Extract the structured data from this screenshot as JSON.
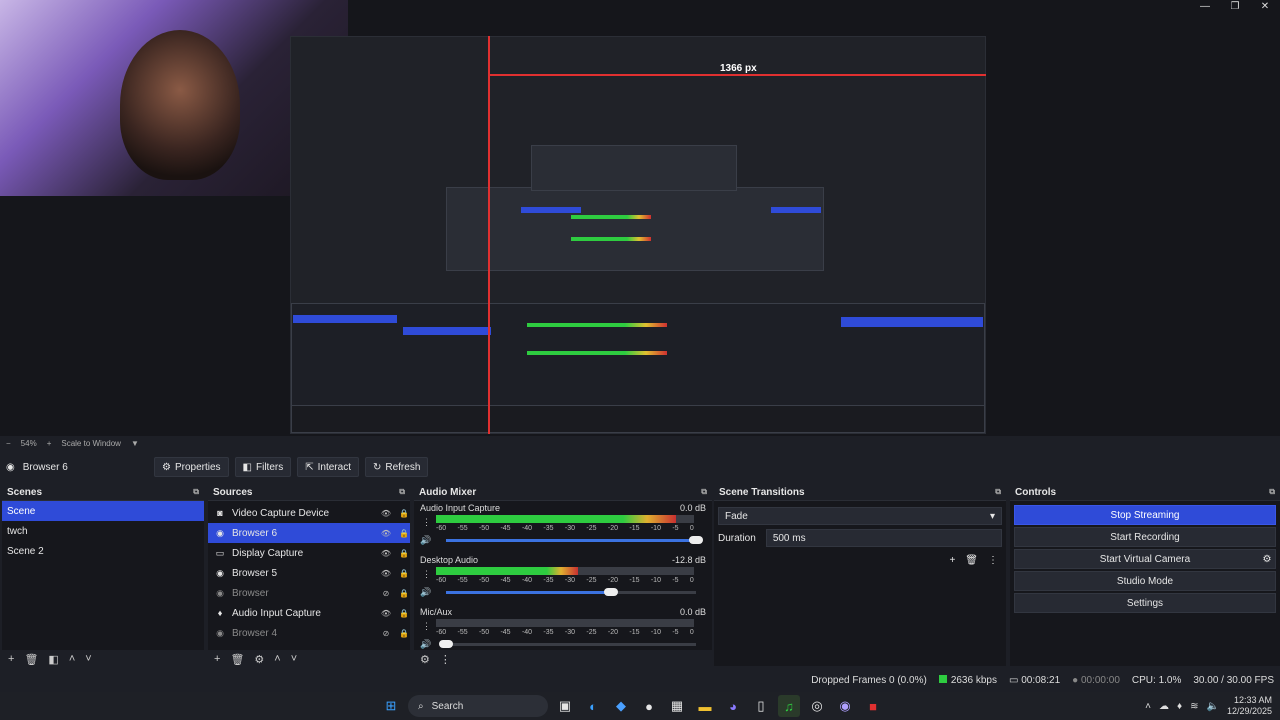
{
  "window": {
    "controls": [
      "—",
      "❐",
      "✕"
    ]
  },
  "preview": {
    "nested_width_label": "1366 px",
    "zoom_percent": "54%",
    "scale_mode": "Scale to Window"
  },
  "toolbar": {
    "source_name": "Browser 6",
    "properties": "Properties",
    "filters": "Filters",
    "interact": "Interact",
    "refresh": "Refresh"
  },
  "scenes": {
    "title": "Scenes",
    "items": [
      "Scene",
      "twch",
      "Scene 2"
    ],
    "selected_index": 0
  },
  "sources": {
    "title": "Sources",
    "items": [
      {
        "name": "Video Capture Device",
        "icon": "camera-icon",
        "visible": true
      },
      {
        "name": "Browser 6",
        "icon": "globe-icon",
        "visible": true,
        "selected": true
      },
      {
        "name": "Display Capture",
        "icon": "monitor-icon",
        "visible": true
      },
      {
        "name": "Browser 5",
        "icon": "globe-icon",
        "visible": true
      },
      {
        "name": "Browser",
        "icon": "globe-icon",
        "visible": false
      },
      {
        "name": "Audio Input Capture",
        "icon": "mic-icon",
        "visible": true
      },
      {
        "name": "Browser 4",
        "icon": "globe-icon",
        "visible": false
      }
    ]
  },
  "mixer": {
    "title": "Audio Mixer",
    "ticks": [
      "-60",
      "-55",
      "-50",
      "-45",
      "-40",
      "-35",
      "-30",
      "-25",
      "-20",
      "-15",
      "-10",
      "-5",
      "0"
    ],
    "channels": [
      {
        "name": "Audio Input Capture",
        "db": "0.0 dB",
        "level": 0.93,
        "volume": 1.0,
        "color": "green"
      },
      {
        "name": "Desktop Audio",
        "db": "-12.8 dB",
        "level": 0.55,
        "volume": 0.66,
        "color": "green"
      },
      {
        "name": "Mic/Aux",
        "db": "0.0 dB",
        "level": 0.0,
        "volume": 0.0,
        "color": "gray"
      }
    ]
  },
  "transitions": {
    "title": "Scene Transitions",
    "selected": "Fade",
    "duration_label": "Duration",
    "duration_value": "500 ms"
  },
  "controls": {
    "title": "Controls",
    "stop_streaming": "Stop Streaming",
    "start_recording": "Start Recording",
    "start_virtual_camera": "Start Virtual Camera",
    "studio_mode": "Studio Mode",
    "settings": "Settings"
  },
  "status": {
    "dropped_frames": "Dropped Frames 0 (0.0%)",
    "bitrate": "2636 kbps",
    "stream_time": "00:08:21",
    "rec_time": "00:00:00",
    "cpu": "CPU: 1.0%",
    "fps": "30.00 / 30.00 FPS"
  },
  "taskbar": {
    "search_label": "Search",
    "time": "12:33 AM",
    "date": "12/29/2025"
  },
  "colors": {
    "accent": "#2f4bd8",
    "background": "#1d1f26",
    "meter_green": "#2ecc40",
    "rec_red": "#e03030"
  }
}
